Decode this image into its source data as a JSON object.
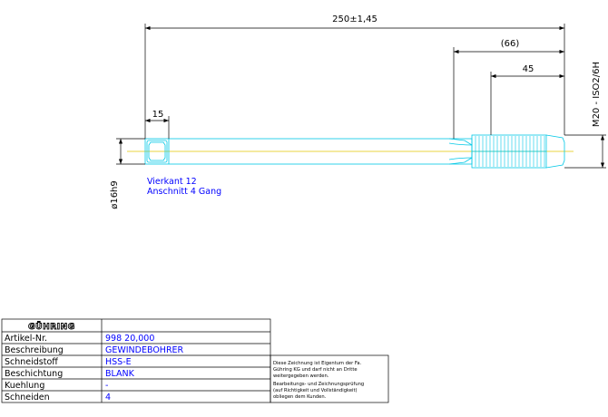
{
  "dimensions": {
    "overall_length": "250±1,45",
    "length_66": "(66)",
    "length_45": "45",
    "length_15": "15",
    "thread": "M20 - ISO2/6H",
    "shank_diameter": "ø16h9"
  },
  "notes": [
    "Vierkant 12",
    "Anschnitt 4 Gang"
  ],
  "title_block": {
    "logo": "GÜHRING",
    "rows": [
      {
        "label": "Artikel-Nr.",
        "value": "998 20,000"
      },
      {
        "label": "Beschreibung",
        "value": "GEWINDEBOHRER"
      },
      {
        "label": "Schneidstoff",
        "value": "HSS-E"
      },
      {
        "label": "Beschichtung",
        "value": "BLANK"
      },
      {
        "label": "Kuehlung",
        "value": "-"
      },
      {
        "label": "Schneiden",
        "value": "4"
      }
    ]
  },
  "disclaimer": [
    "Diese Zeichnung ist Eigentum der Fa.",
    "Gühring KG und darf nicht an Dritte",
    "weitergegeben werden.",
    "Bearbeitungs- und Zeichnungsprüfung",
    "(auf Richtigkeit und Vollständigkeit)",
    "obliegen dem Kunden."
  ],
  "colors": {
    "part_outline": "#00c8e6",
    "centerline": "#e0c800",
    "dimension": "#000000",
    "note_text": "#0000ff"
  }
}
